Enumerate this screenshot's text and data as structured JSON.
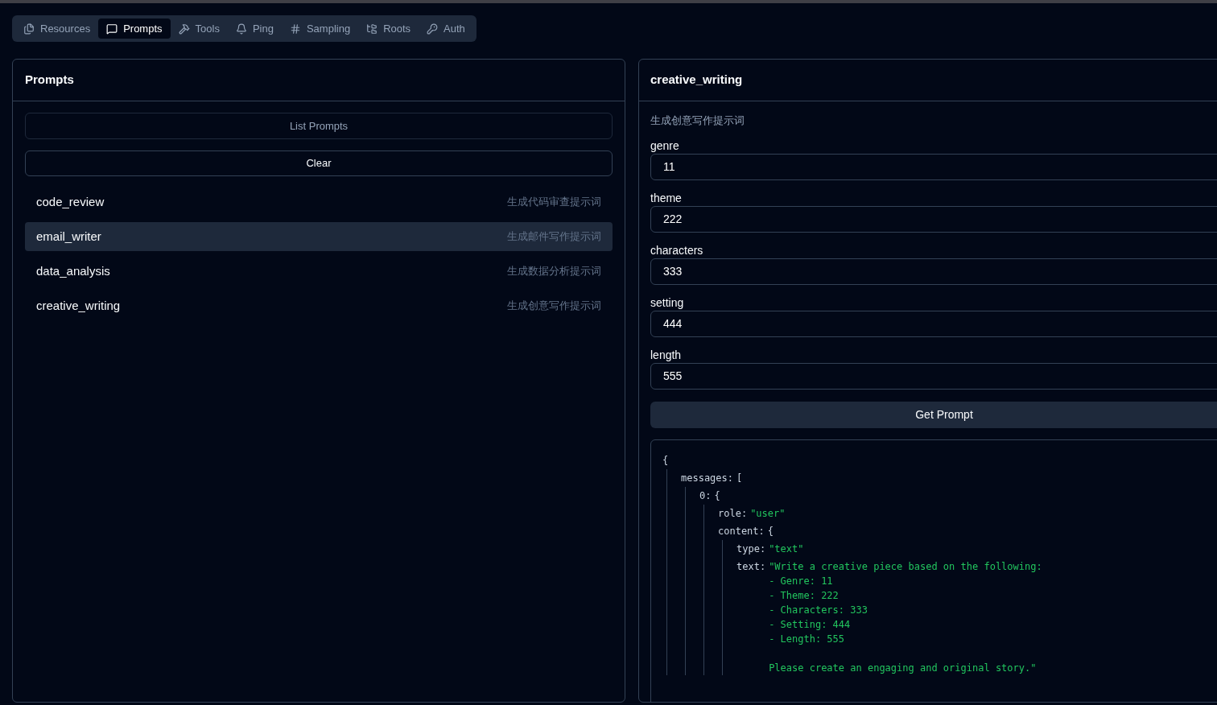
{
  "tabs": [
    {
      "label": "Resources",
      "selected": false
    },
    {
      "label": "Prompts",
      "selected": true
    },
    {
      "label": "Tools",
      "selected": false
    },
    {
      "label": "Ping",
      "selected": false
    },
    {
      "label": "Sampling",
      "selected": false
    },
    {
      "label": "Roots",
      "selected": false
    },
    {
      "label": "Auth",
      "selected": false
    }
  ],
  "prompts_panel": {
    "title": "Prompts",
    "list_button": {
      "label": "List Prompts",
      "disabled": true
    },
    "clear_button": "Clear",
    "items": [
      {
        "name": "code_review",
        "description": "生成代码审查提示词",
        "selected": false
      },
      {
        "name": "email_writer",
        "description": "生成邮件写作提示词",
        "selected": true
      },
      {
        "name": "data_analysis",
        "description": "生成数据分析提示词",
        "selected": false
      },
      {
        "name": "creative_writing",
        "description": "生成创意写作提示词",
        "selected": false
      }
    ]
  },
  "detail_panel": {
    "title": "creative_writing",
    "description": "生成创意写作提示词",
    "arguments": [
      {
        "label": "genre",
        "value": "11"
      },
      {
        "label": "theme",
        "value": "222"
      },
      {
        "label": "characters",
        "value": "333"
      },
      {
        "label": "setting",
        "value": "444"
      },
      {
        "label": "length",
        "value": "555"
      }
    ],
    "get_button": "Get Prompt",
    "result": {
      "open": "{",
      "children": [
        {
          "key": "messages:",
          "open": "[",
          "children": [
            {
              "key": "0:",
              "open": "{",
              "children": [
                {
                  "key": "role:",
                  "value": "\"user\""
                },
                {
                  "key": "content:",
                  "open": "{",
                  "children": [
                    {
                      "key": "type:",
                      "value": "\"text\""
                    },
                    {
                      "key": "text:",
                      "value": "\"Write a creative piece based on the following:\n- Genre: 11\n- Theme: 222\n- Characters: 333\n- Setting: 444\n- Length: 555\n\nPlease create an engaging and original story.\""
                    }
                  ]
                }
              ]
            }
          ]
        }
      ]
    }
  }
}
